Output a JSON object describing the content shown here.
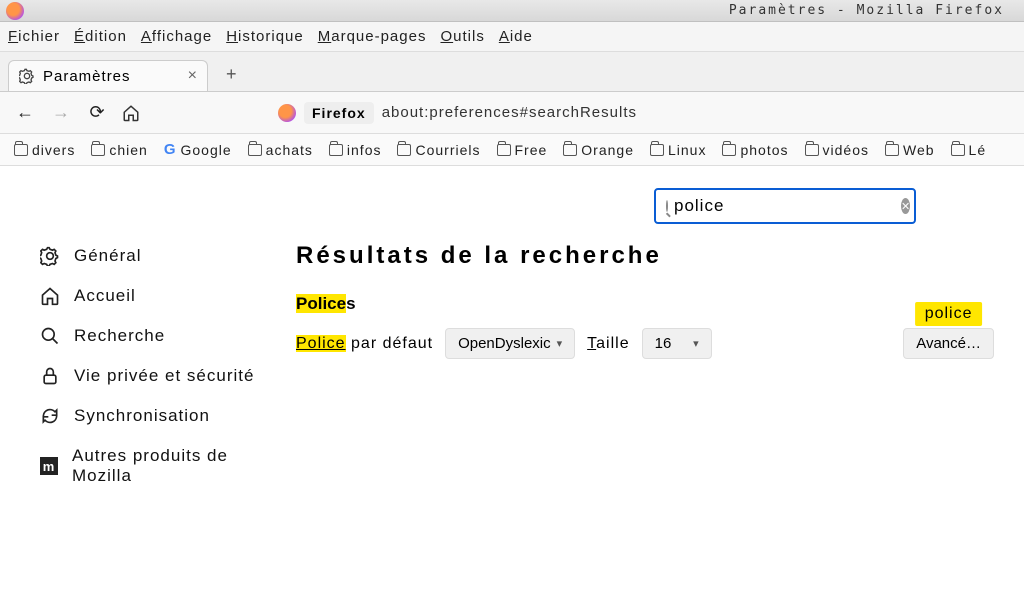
{
  "window": {
    "title": "Paramètres - Mozilla Firefox"
  },
  "menubar": [
    {
      "label": "Fichier",
      "u": "F"
    },
    {
      "label": "Édition",
      "u": "É"
    },
    {
      "label": "Affichage",
      "u": "A"
    },
    {
      "label": "Historique",
      "u": "H"
    },
    {
      "label": "Marque-pages",
      "u": "M"
    },
    {
      "label": "Outils",
      "u": "O"
    },
    {
      "label": "Aide",
      "u": "A"
    }
  ],
  "tab": {
    "title": "Paramètres"
  },
  "url": {
    "badge": "Firefox",
    "path": "about:preferences#searchResults"
  },
  "bookmarks": [
    "divers",
    "chien",
    "Google",
    "achats",
    "infos",
    "Courriels",
    "Free",
    "Orange",
    "Linux",
    "photos",
    "vidéos",
    "Web",
    "Lé"
  ],
  "search": {
    "value": "police"
  },
  "sidebar": {
    "general": "Général",
    "home": "Accueil",
    "search": "Recherche",
    "privacy": "Vie privée et sécurité",
    "sync": "Synchronisation",
    "more": "Autres produits de Mozilla",
    "more_m": "m"
  },
  "main": {
    "results_title": "Résultats de la recherche",
    "section_hl": "Police",
    "section_suffix": "s",
    "label_hl": "Police",
    "label_rest": " par défaut",
    "font_value": "OpenDyslexic",
    "size_label": "Taille",
    "size_value": "16",
    "badge": "police",
    "advanced": "Avancé…"
  }
}
